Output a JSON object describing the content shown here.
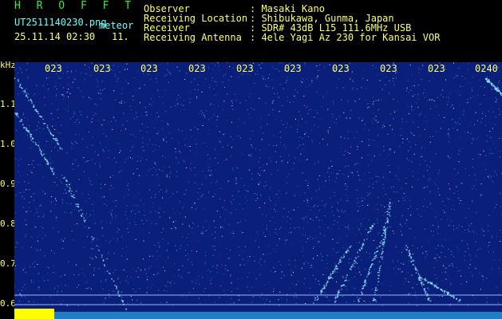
{
  "header": {
    "app_name": "H R O F F T",
    "file_name": "UT2511140230.png",
    "type": "meteor",
    "datetime": "25.11.14 02:30",
    "frequency_short": "11.",
    "observer_label": "Observer",
    "observer_value": ": Masaki Kano",
    "location_label": "Receiving Location",
    "location_value": ": Shibukawa, Gunma, Japan",
    "receiver_label": "Receiver",
    "receiver_value": ": SDR# 43dB L15 111.6MHz USB",
    "antenna_label": "Receiving Antenna",
    "antenna_value": ": 4ele Yagi Az 230 for Kansai VOR"
  },
  "spectrogram": {
    "unit": "kHz",
    "y_ticks": [
      "1.1",
      "1.0",
      "0.9",
      "0.8",
      "0.7",
      "0.6"
    ],
    "x_ticks": [
      "023",
      "023",
      "023",
      "023",
      "023",
      "023",
      "023",
      "023",
      "023",
      "0240"
    ],
    "background_color": "#0a1f7a",
    "signal_color": "#66ccff",
    "marker_color": "#ffff00"
  }
}
